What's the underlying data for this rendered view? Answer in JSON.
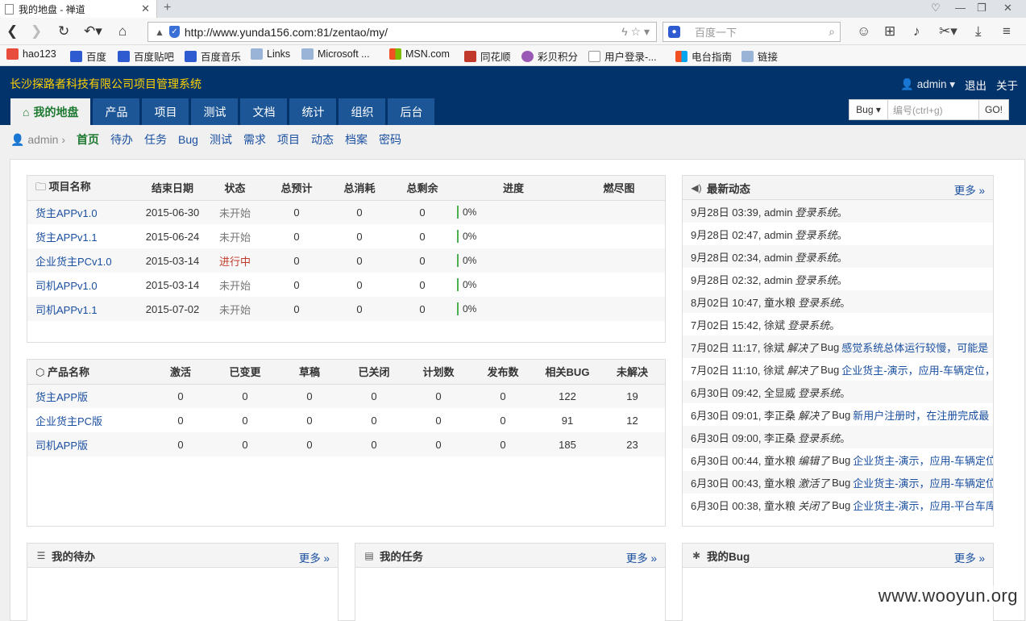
{
  "browser": {
    "tab_title": "我的地盘 - 禅道",
    "url": "http://www.yunda156.com:81/zentao/my/",
    "search_placeholder": "百度一下",
    "bookmarks": [
      "hao123",
      "百度",
      "百度贴吧",
      "百度音乐",
      "Links",
      "Microsoft ...",
      "MSN.com",
      "同花顺",
      "彩贝积分",
      "用户登录-...",
      "电台指南",
      "链接"
    ]
  },
  "app": {
    "title": "长沙探路者科技有限公司项目管理系统",
    "user": "admin",
    "logout": "退出",
    "about": "关于",
    "nav": [
      "我的地盘",
      "产品",
      "项目",
      "测试",
      "文档",
      "统计",
      "组织",
      "后台"
    ],
    "quickjump": {
      "type": "Bug",
      "placeholder": "编号(ctrl+g)",
      "go": "GO!"
    },
    "subnav": {
      "user": "admin",
      "items": [
        "首页",
        "待办",
        "任务",
        "Bug",
        "测试",
        "需求",
        "项目",
        "动态",
        "档案",
        "密码"
      ]
    }
  },
  "projects": {
    "headers": [
      "项目名称",
      "结束日期",
      "状态",
      "总预计",
      "总消耗",
      "总剩余",
      "进度",
      "燃尽图"
    ],
    "rows": [
      {
        "name": "货主APPv1.0",
        "end": "2015-06-30",
        "status": "未开始",
        "est": "0",
        "used": "0",
        "left": "0",
        "progress": "0%"
      },
      {
        "name": "货主APPv1.1",
        "end": "2015-06-24",
        "status": "未开始",
        "est": "0",
        "used": "0",
        "left": "0",
        "progress": "0%"
      },
      {
        "name": "企业货主PCv1.0",
        "end": "2015-03-14",
        "status": "进行中",
        "est": "0",
        "used": "0",
        "left": "0",
        "progress": "0%"
      },
      {
        "name": "司机APPv1.0",
        "end": "2015-03-14",
        "status": "未开始",
        "est": "0",
        "used": "0",
        "left": "0",
        "progress": "0%"
      },
      {
        "name": "司机APPv1.1",
        "end": "2015-07-02",
        "status": "未开始",
        "est": "0",
        "used": "0",
        "left": "0",
        "progress": "0%"
      }
    ]
  },
  "products": {
    "headers": [
      "产品名称",
      "激活",
      "已变更",
      "草稿",
      "已关闭",
      "计划数",
      "发布数",
      "相关BUG",
      "未解决"
    ],
    "rows": [
      [
        "货主APP版",
        "0",
        "0",
        "0",
        "0",
        "0",
        "0",
        "122",
        "19"
      ],
      [
        "企业货主PC版",
        "0",
        "0",
        "0",
        "0",
        "0",
        "0",
        "91",
        "12"
      ],
      [
        "司机APP版",
        "0",
        "0",
        "0",
        "0",
        "0",
        "0",
        "185",
        "23"
      ]
    ]
  },
  "dynamics": {
    "title": "最新动态",
    "more": "更多",
    "items": [
      {
        "time": "9月28日 03:39, admin",
        "action": "登录系统",
        "obj": "",
        "target": "",
        "end": "。"
      },
      {
        "time": "9月28日 02:47, admin",
        "action": "登录系统",
        "obj": "",
        "target": "",
        "end": "。"
      },
      {
        "time": "9月28日 02:34, admin",
        "action": "登录系统",
        "obj": "",
        "target": "",
        "end": "。"
      },
      {
        "time": "9月28日 02:32, admin",
        "action": "登录系统",
        "obj": "",
        "target": "",
        "end": "。"
      },
      {
        "time": "8月02日 10:47, 童水粮",
        "action": "登录系统",
        "obj": "",
        "target": "",
        "end": "。"
      },
      {
        "time": "7月02日 15:42, 徐斌",
        "action": "登录系统",
        "obj": "",
        "target": "",
        "end": "。"
      },
      {
        "time": "7月02日 11:17, 徐斌",
        "action": "解决了",
        "obj": "Bug",
        "target": "感觉系统总体运行较慢，可能是",
        "end": ""
      },
      {
        "time": "7月02日 11:10, 徐斌",
        "action": "解决了",
        "obj": "Bug",
        "target": "企业货主-演示，应用-车辆定位，",
        "end": ""
      },
      {
        "time": "6月30日 09:42, 全显威",
        "action": "登录系统",
        "obj": "",
        "target": "",
        "end": "。"
      },
      {
        "time": "6月30日 09:01, 李正桑",
        "action": "解决了",
        "obj": "Bug",
        "target": "新用户注册时，在注册完成最",
        "end": ""
      },
      {
        "time": "6月30日 09:00, 李正桑",
        "action": "登录系统",
        "obj": "",
        "target": "",
        "end": "。"
      },
      {
        "time": "6月30日 00:44, 童水粮",
        "action": "编辑了",
        "obj": "Bug",
        "target": "企业货主-演示，应用-车辆定位",
        "end": ""
      },
      {
        "time": "6月30日 00:43, 童水粮",
        "action": "激活了",
        "obj": "Bug",
        "target": "企业货主-演示，应用-车辆定位",
        "end": ""
      },
      {
        "time": "6月30日 00:38, 童水粮",
        "action": "关闭了",
        "obj": "Bug",
        "target": "企业货主-演示，应用-平台车库",
        "end": ""
      }
    ]
  },
  "bottom_panels": {
    "todo": {
      "title": "我的待办",
      "more": "更多"
    },
    "task": {
      "title": "我的任务",
      "more": "更多"
    },
    "bug": {
      "title": "我的Bug",
      "more": "更多"
    }
  },
  "watermark": "www.wooyun.org",
  "colors": {
    "header_bg": "#03336b",
    "nav_bg": "#1d5697",
    "title_yellow": "#ffd200",
    "link": "#1a4fa0",
    "active_green": "#1f7a32"
  }
}
